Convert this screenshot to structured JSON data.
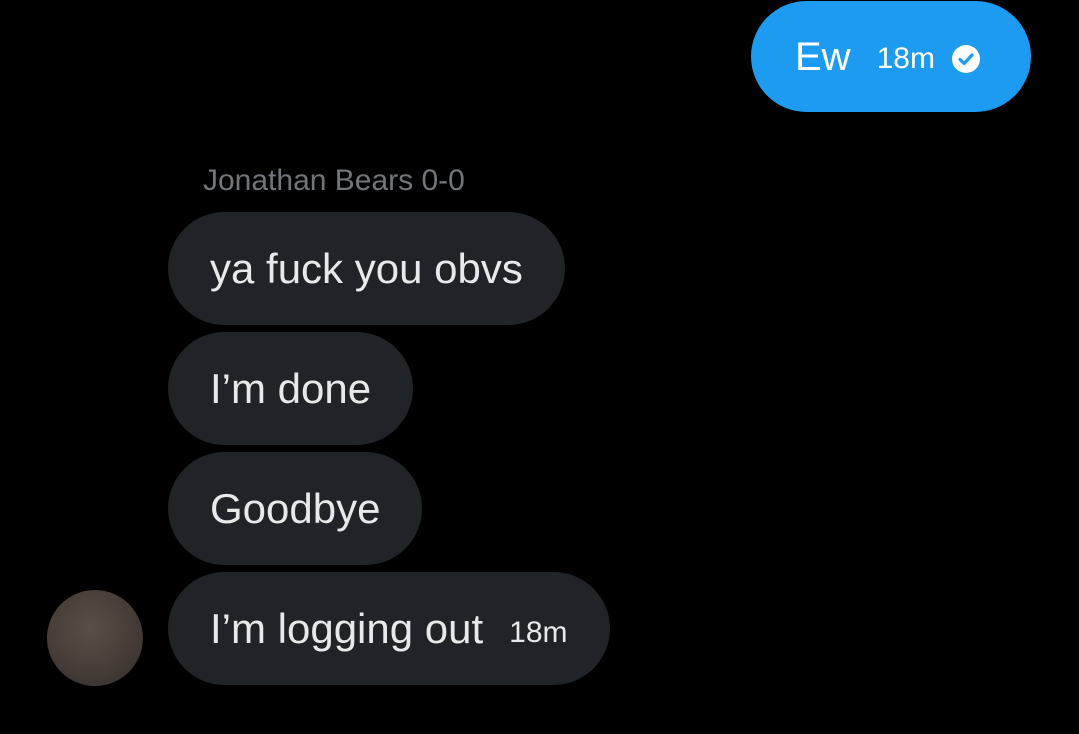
{
  "sent_message": {
    "text": "Ew",
    "time": "18m",
    "status_icon": "check-circle-icon"
  },
  "thread": {
    "sender_name": "Jonathan Bears 0-0",
    "messages": [
      {
        "text": "ya fuck you obvs"
      },
      {
        "text": "I’m done"
      },
      {
        "text": "Goodbye"
      },
      {
        "text": "I’m logging out",
        "time": "18m"
      }
    ]
  },
  "colors": {
    "background": "#000000",
    "sent_bubble": "#1d9bf0",
    "received_bubble": "#202327",
    "muted_text": "#71767b"
  }
}
